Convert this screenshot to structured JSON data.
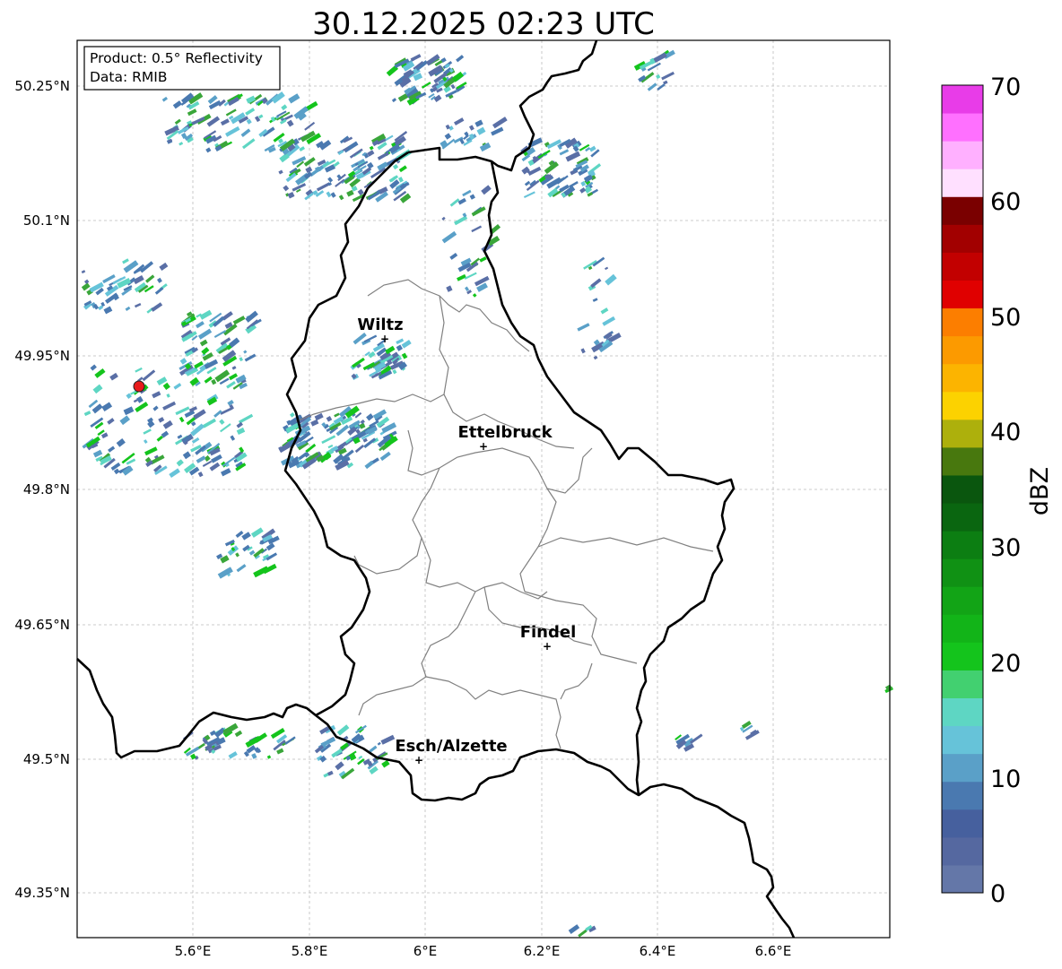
{
  "title": "30.12.2025 02:23 UTC",
  "info_box": {
    "product": "Product: 0.5° Reflectivity",
    "data": "Data: RMIB"
  },
  "axes": {
    "lon_ticks": [
      "5.6°E",
      "5.8°E",
      "6°E",
      "6.2°E",
      "6.4°E",
      "6.6°E"
    ],
    "lat_ticks": [
      "50.25°N",
      "50.1°N",
      "49.95°N",
      "49.8°N",
      "49.65°N",
      "49.5°N",
      "49.35°N"
    ],
    "grid": true
  },
  "cities": [
    {
      "name": "Wiltz",
      "lon": 5.93,
      "lat": 49.967
    },
    {
      "name": "Ettelbruck",
      "lon": 6.1,
      "lat": 49.848
    },
    {
      "name": "Findel",
      "lon": 6.21,
      "lat": 49.626
    },
    {
      "name": "Esch/Alzette",
      "lon": 5.99,
      "lat": 49.499
    }
  ],
  "radar_site": {
    "lon": 5.505,
    "lat": 49.915,
    "color": "#e81c1c"
  },
  "colorbar": {
    "label": "dBZ",
    "tick_labels": [
      "0",
      "10",
      "20",
      "30",
      "40",
      "50",
      "60",
      "70"
    ],
    "colors": [
      "#6477a8",
      "#5568a0",
      "#46609e",
      "#4a79b0",
      "#5aa0c8",
      "#66c3d9",
      "#5ed6c3",
      "#42d070",
      "#14c41c",
      "#12b418",
      "#12a416",
      "#109114",
      "#0c7e12",
      "#0a6610",
      "#0a560e",
      "#48780e",
      "#adb00c",
      "#fcd200",
      "#fcb400",
      "#fc9a00",
      "#fc7e00",
      "#e00000",
      "#c20000",
      "#a20000",
      "#7a0000",
      "#ffe0ff",
      "#ffb0ff",
      "#ff70ff",
      "#e83ce8"
    ],
    "range": [
      0,
      70
    ]
  },
  "colors": {
    "border": "#000000",
    "canton": "#808080",
    "grid": "#bbbbbb"
  }
}
